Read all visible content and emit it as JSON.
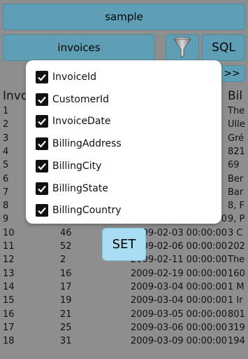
{
  "toolbar": {
    "database_label": "sample",
    "table_label": "invoices",
    "sql_label": "SQL",
    "next_label": ">>"
  },
  "grid": {
    "headers": [
      "Invo",
      "",
      "",
      "Bil"
    ],
    "rows": [
      [
        "1",
        "",
        "",
        "The"
      ],
      [
        "2",
        "",
        "",
        "Ulle"
      ],
      [
        "3",
        "",
        "",
        "Gré"
      ],
      [
        "4",
        "",
        "",
        "821"
      ],
      [
        "5",
        "",
        "",
        "69"
      ],
      [
        "6",
        "",
        "",
        "Ber"
      ],
      [
        "7",
        "",
        "",
        "Bar"
      ],
      [
        "8",
        "",
        "",
        "8, F"
      ],
      [
        "9",
        "42",
        "2009-02-02 00:00:00",
        "9, P"
      ],
      [
        "10",
        "46",
        "2009-02-03 00:00:00",
        "3 C"
      ],
      [
        "11",
        "52",
        "2009-02-06 00:00:00",
        "202"
      ],
      [
        "12",
        "2",
        "2009-02-11 00:00:00",
        "The"
      ],
      [
        "13",
        "16",
        "2009-02-19 00:00:00",
        "160"
      ],
      [
        "14",
        "17",
        "2009-03-04 00:00:00",
        "1 M"
      ],
      [
        "15",
        "19",
        "2009-03-04 00:00:00",
        "1 Ir"
      ],
      [
        "16",
        "21",
        "2009-03-05 00:00:00",
        "801"
      ],
      [
        "17",
        "25",
        "2009-03-06 00:00:00",
        "319"
      ],
      [
        "18",
        "31",
        "2009-03-09 00:00:00",
        "194"
      ]
    ]
  },
  "dialog": {
    "options": [
      {
        "label": "InvoiceId",
        "checked": true
      },
      {
        "label": "CustomerId",
        "checked": true
      },
      {
        "label": "InvoiceDate",
        "checked": true
      },
      {
        "label": "BillingAddress",
        "checked": true
      },
      {
        "label": "BillingCity",
        "checked": true
      },
      {
        "label": "BillingState",
        "checked": true
      },
      {
        "label": "BillingCountry",
        "checked": true
      }
    ]
  },
  "set_label": "SET",
  "colors": {
    "button": "#5f9fb6",
    "set_button": "#a8ddf4",
    "overlay": "#8e8e8e"
  },
  "icons": {
    "filter": "funnel-icon",
    "check": "checkmark-icon"
  }
}
